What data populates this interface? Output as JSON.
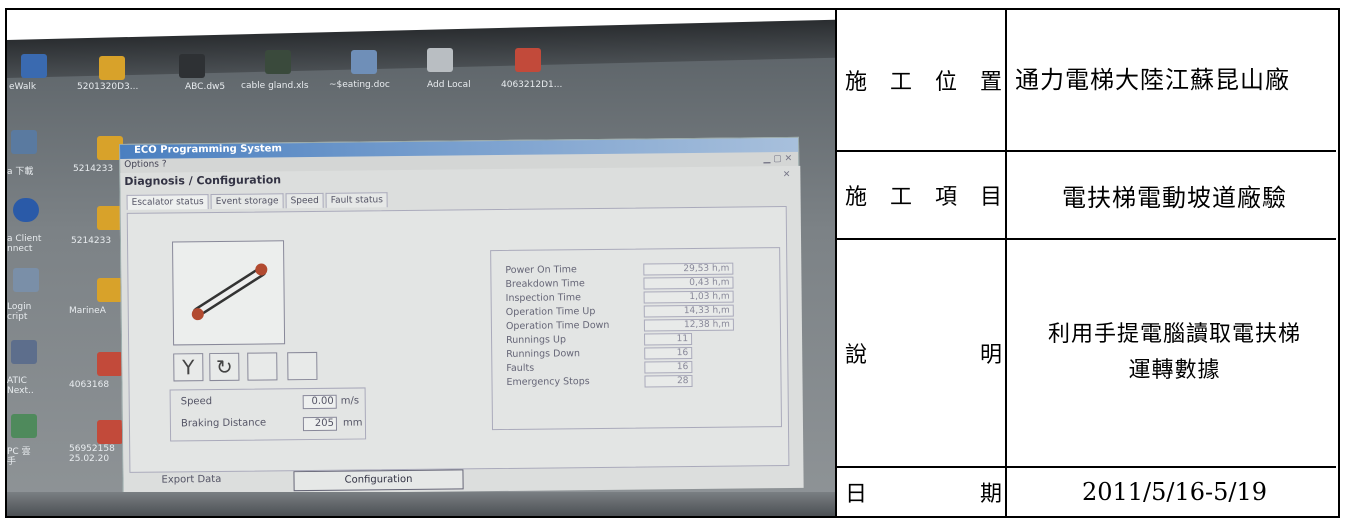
{
  "labels": {
    "location": [
      "施",
      "工",
      "位",
      "置"
    ],
    "item": [
      "施",
      "工",
      "項",
      "目"
    ],
    "description": [
      "說",
      "明"
    ],
    "date": [
      "日",
      "期"
    ]
  },
  "values": {
    "location": "通力電梯大陸江蘇昆山廠",
    "item": "電扶梯電動坡道廠驗",
    "description_line1": "利用手提電腦讀取電扶梯",
    "description_line2": "運轉數據",
    "date": "2011/5/16-5/19"
  },
  "photo": {
    "desktop_labels": [
      "eWalk",
      "5201320D3...",
      "ABC.dw5",
      "cable gland.xls",
      "~$eating.doc",
      "Add Local",
      "4063212D1...",
      "a 下載",
      "5214233",
      "a Client",
      "nnect",
      "5214233",
      "Login",
      "cript",
      "MarineA",
      "ATIC",
      "Next..",
      "4063168",
      "PC 雲",
      "手",
      "56952158",
      "25.02.20"
    ],
    "app_title": "ECO Programming System",
    "app_menu": "Options  ?",
    "diag_title": "Diagnosis / Configuration",
    "tabs": [
      "Escalator status",
      "Event storage",
      "Speed",
      "Fault status"
    ],
    "speed": {
      "label": "Speed",
      "value": "0.00",
      "unit": "m/s"
    },
    "braking": {
      "label": "Braking Distance",
      "value": "205",
      "unit": "mm"
    },
    "stats": [
      {
        "label": "Power On Time",
        "value": "29,53 h,m"
      },
      {
        "label": "Breakdown Time",
        "value": "0,43 h,m"
      },
      {
        "label": "Inspection Time",
        "value": "1,03 h,m"
      },
      {
        "label": "Operation Time Up",
        "value": "14,33 h,m"
      },
      {
        "label": "Operation Time Down",
        "value": "12,38 h,m"
      },
      {
        "label": "Runnings Up",
        "value": "11"
      },
      {
        "label": "Runnings Down",
        "value": "16"
      },
      {
        "label": "Faults",
        "value": "16"
      },
      {
        "label": "Emergency Stops",
        "value": "28"
      }
    ],
    "export_label": "Export Data",
    "config_button": "Configuration"
  },
  "colors": {
    "border": "#000000",
    "window_title": "#4a7fc0"
  }
}
